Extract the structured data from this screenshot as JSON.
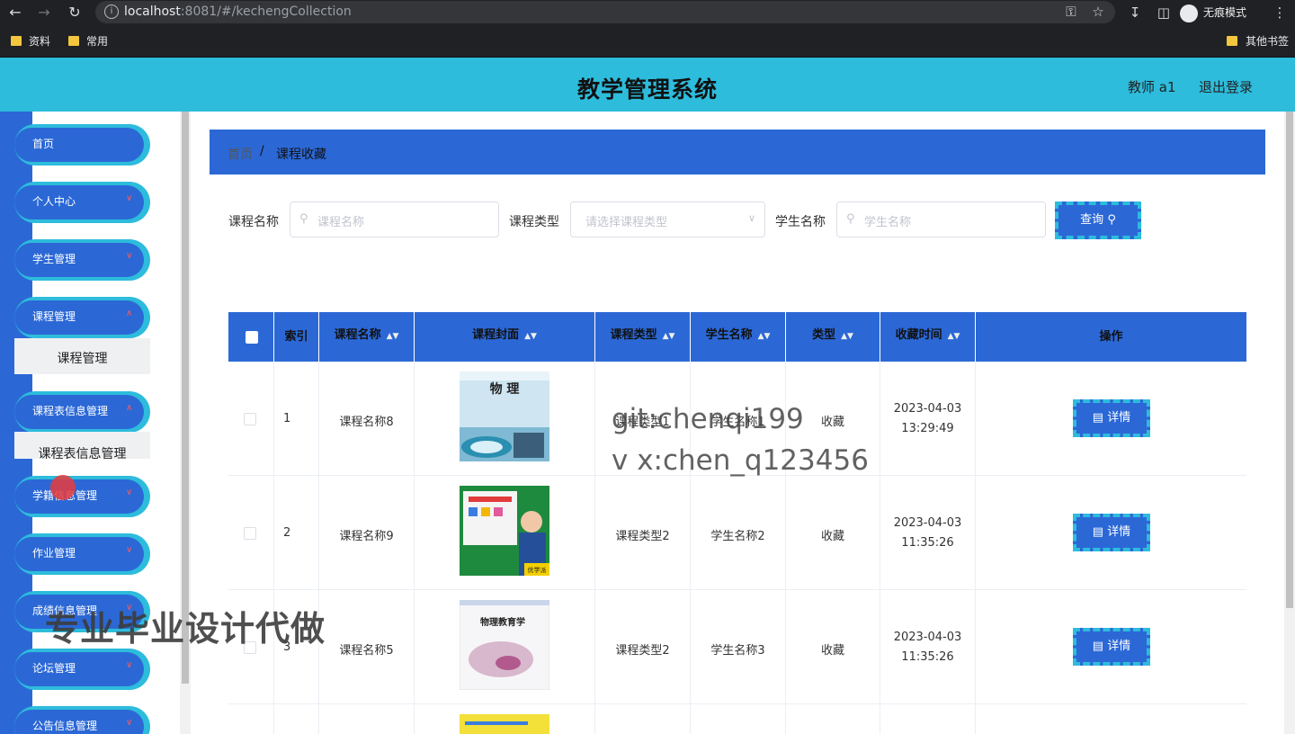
{
  "browser": {
    "url_host": "localhost",
    "url_rest": ":8081/#/kechengCollection",
    "incognito_label": "无痕模式",
    "bookmarks": [
      "资料",
      "常用"
    ],
    "other_bookmarks": "其他书签"
  },
  "header": {
    "title": "教学管理系统",
    "user": "教师 a1",
    "logout": "退出登录"
  },
  "sidebar": {
    "items": [
      {
        "label": "首页"
      },
      {
        "label": "个人中心"
      },
      {
        "label": "学生管理"
      },
      {
        "label": "课程管理"
      },
      {
        "label": "课程表信息管理"
      },
      {
        "label": "学籍信息管理"
      },
      {
        "label": "作业管理"
      },
      {
        "label": "成绩信息管理"
      },
      {
        "label": "论坛管理"
      },
      {
        "label": "公告信息管理"
      }
    ],
    "submenus": [
      "课程管理",
      "课程表信息管理"
    ]
  },
  "breadcrumb": {
    "home": "首页",
    "sep": "/",
    "current": "课程收藏"
  },
  "filters": {
    "course_name_label": "课程名称",
    "course_name_placeholder": "课程名称",
    "course_type_label": "课程类型",
    "course_type_placeholder": "请选择课程类型",
    "student_name_label": "学生名称",
    "student_name_placeholder": "学生名称",
    "search_button": "查询"
  },
  "table": {
    "columns": [
      "索引",
      "课程名称",
      "课程封面",
      "课程类型",
      "学生名称",
      "类型",
      "收藏时间",
      "操作"
    ],
    "detail_label": "详情",
    "rows": [
      {
        "index": "1",
        "course_name": "课程名称8",
        "course_type": "课程类型1",
        "student": "学生名称1",
        "type": "收藏",
        "date": "2023-04-03",
        "time": "13:29:49"
      },
      {
        "index": "2",
        "course_name": "课程名称9",
        "course_type": "课程类型2",
        "student": "学生名称2",
        "type": "收藏",
        "date": "2023-04-03",
        "time": "11:35:26"
      },
      {
        "index": "3",
        "course_name": "课程名称5",
        "course_type": "课程类型2",
        "student": "学生名称3",
        "type": "收藏",
        "date": "2023-04-03",
        "time": "11:35:26"
      }
    ]
  },
  "covers": [
    {
      "title": "物 理"
    },
    {
      "title": "优学派"
    },
    {
      "title": "物理教育学"
    }
  ],
  "watermarks": {
    "line1": "git:chenqi199",
    "line2": "v x:chen_q123456",
    "line3": "专业毕业设计代做"
  }
}
